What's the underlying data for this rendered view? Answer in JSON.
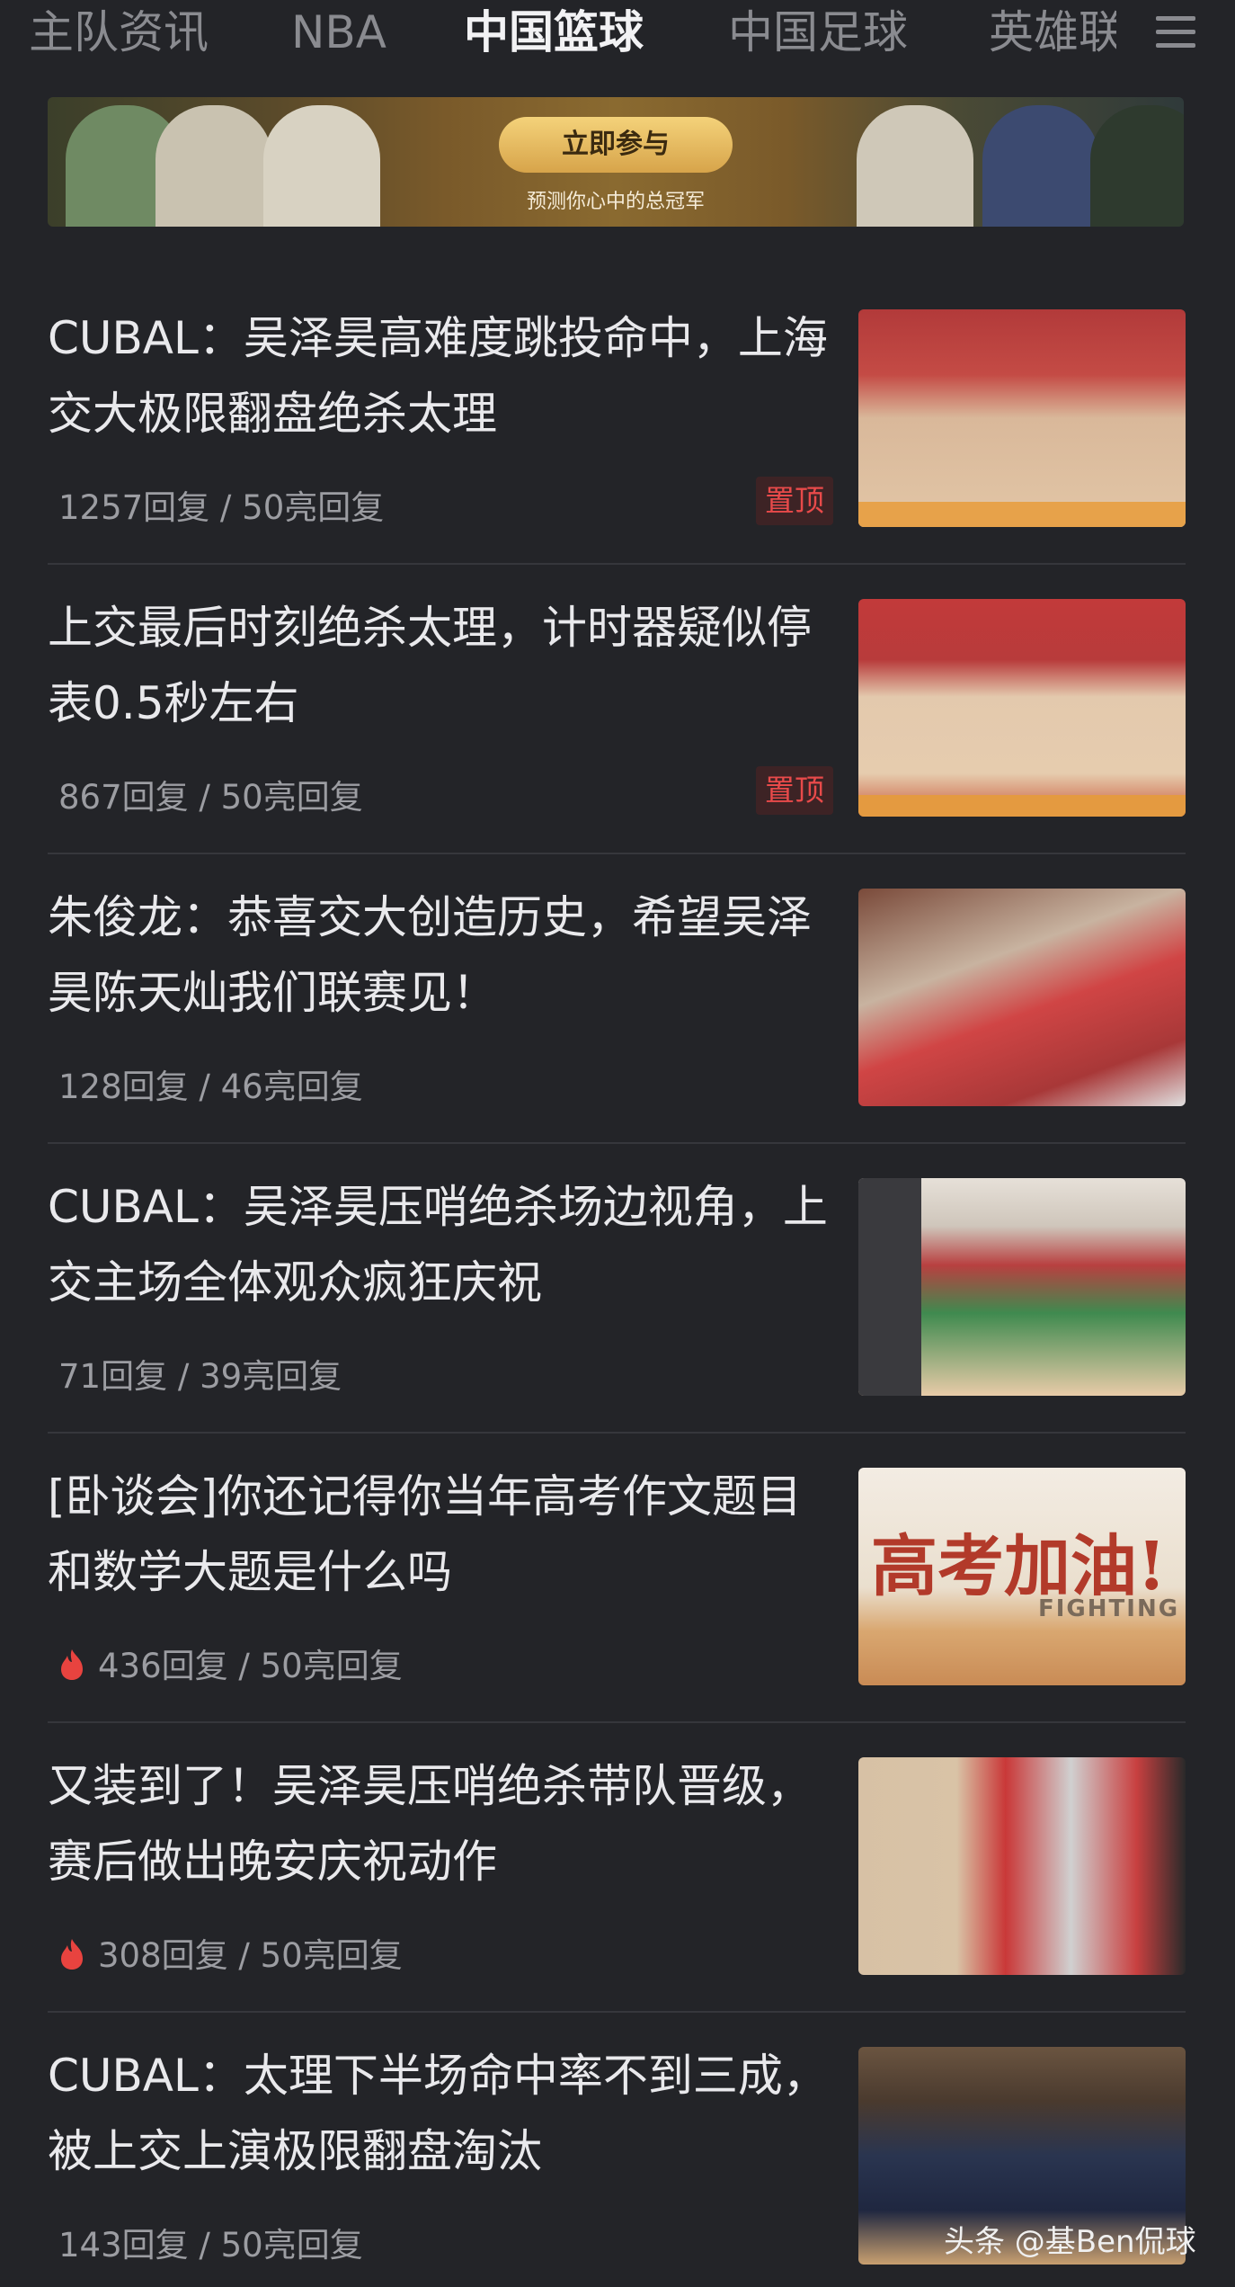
{
  "tabs": [
    "主队资讯",
    "NBA",
    "中国篮球",
    "中国足球",
    "英雄联"
  ],
  "active_tab": "中国篮球",
  "banner": {
    "button_label": "立即参与",
    "subtitle": "预测你心中的总冠军"
  },
  "articles": [
    {
      "title": "CUBAL：吴泽昊高难度跳投命中，上海交大极限翻盘绝杀太理",
      "stats": "1257回复 / 50亮回复",
      "pinned": "置顶",
      "hot": false
    },
    {
      "title": "上交最后时刻绝杀太理，计时器疑似停表0.5秒左右",
      "stats": "867回复 / 50亮回复",
      "pinned": "置顶",
      "hot": false
    },
    {
      "title": "朱俊龙：恭喜交大创造历史，希望吴泽昊陈天灿我们联赛见！",
      "stats": "128回复 / 46亮回复",
      "pinned": "",
      "hot": false
    },
    {
      "title": "CUBAL：吴泽昊压哨绝杀场边视角，上交主场全体观众疯狂庆祝",
      "stats": "71回复 / 39亮回复",
      "pinned": "",
      "hot": false
    },
    {
      "title": "[卧谈会]你还记得你当年高考作文题目和数学大题是什么吗",
      "stats": "436回复 / 50亮回复",
      "pinned": "",
      "hot": true
    },
    {
      "title": "又装到了！吴泽昊压哨绝杀带队晋级，赛后做出晚安庆祝动作",
      "stats": "308回复 / 50亮回复",
      "pinned": "",
      "hot": true
    },
    {
      "title": "CUBAL：太理下半场命中率不到三成，被上交上演极限翻盘淘汰",
      "stats": "143回复 / 50亮回复",
      "pinned": "",
      "hot": false
    }
  ],
  "thumb_texts": {
    "gaokao_main": "高考加油!",
    "gaokao_sub": "FIGHTING"
  },
  "watermark": "头条 @基Ben侃球",
  "colors": {
    "background": "#232428",
    "pin_text": "#e84a4a",
    "pin_bg": "#3d2325",
    "fire": "#e8433f"
  }
}
